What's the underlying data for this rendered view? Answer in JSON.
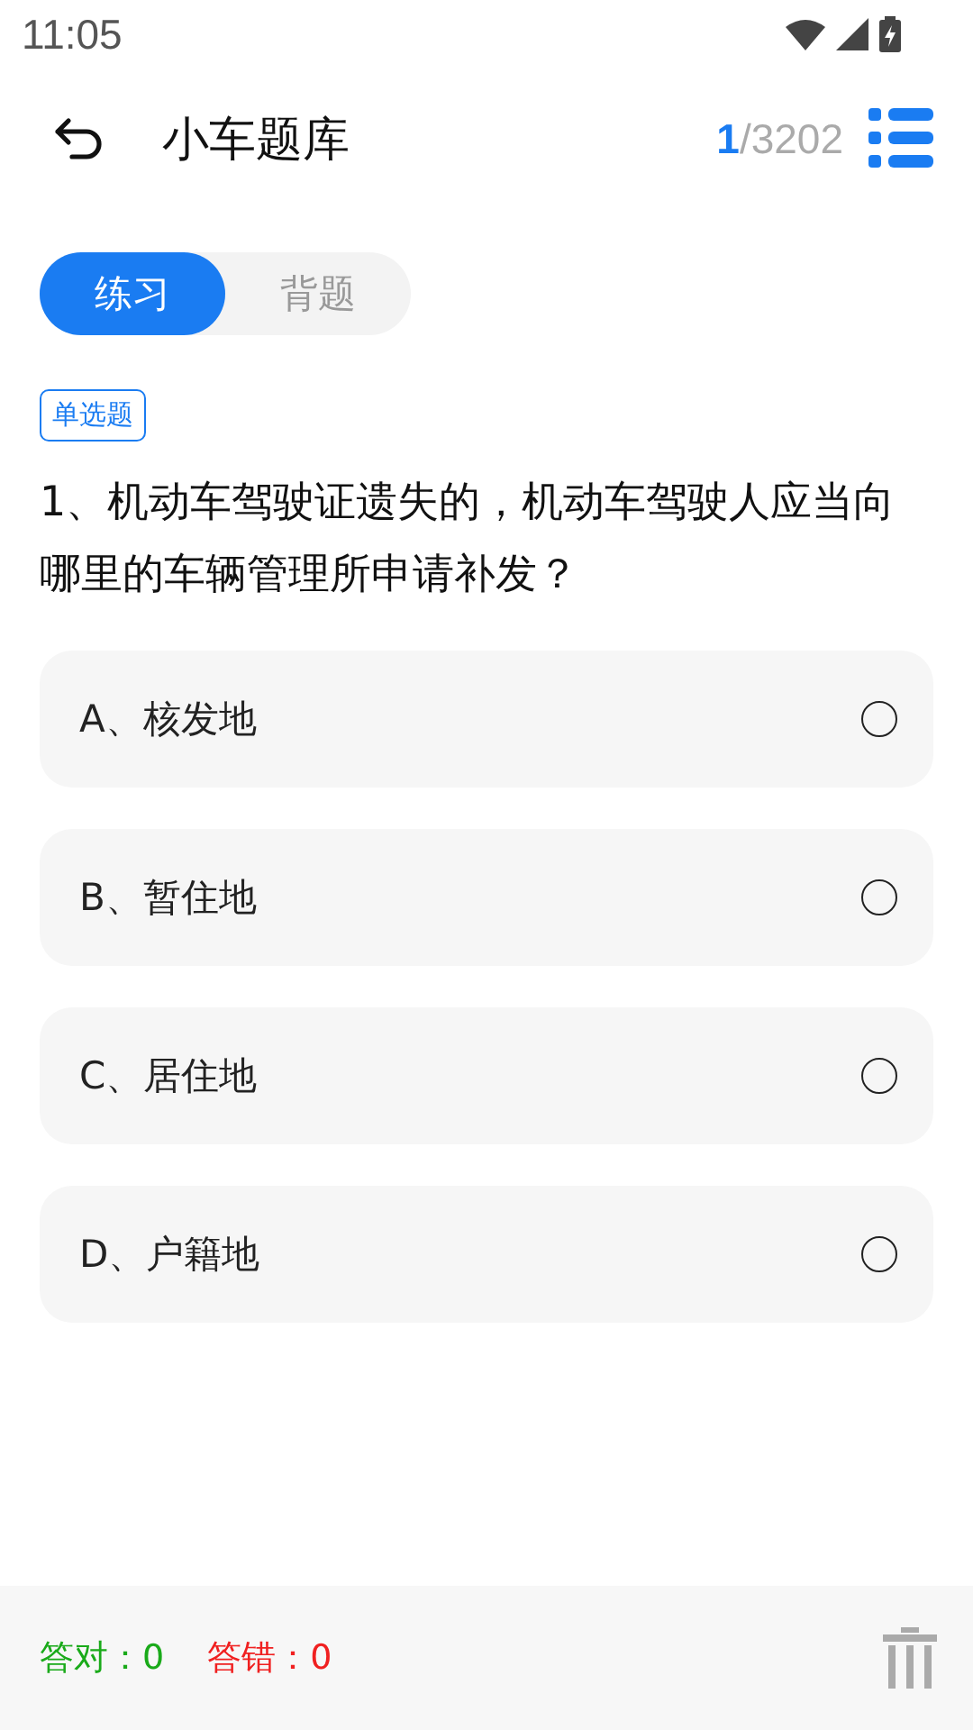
{
  "status_bar": {
    "time": "11:05"
  },
  "header": {
    "title": "小车题库",
    "current": "1",
    "total": "/3202"
  },
  "tabs": [
    {
      "label": "练习",
      "selected": true
    },
    {
      "label": "背题",
      "selected": false
    }
  ],
  "question": {
    "type": "单选题",
    "text": "1、机动车驾驶证遗失的，机动车驾驶人应当向哪里的车辆管理所申请补发？"
  },
  "options": [
    {
      "label": "A、核发地",
      "selected": false
    },
    {
      "label": "B、暂住地",
      "selected": false
    },
    {
      "label": "C、居住地",
      "selected": false
    },
    {
      "label": "D、户籍地",
      "selected": false
    }
  ],
  "footer": {
    "correct_label": "答对：",
    "correct": "0",
    "wrong_label": "答错：",
    "wrong": "0"
  }
}
